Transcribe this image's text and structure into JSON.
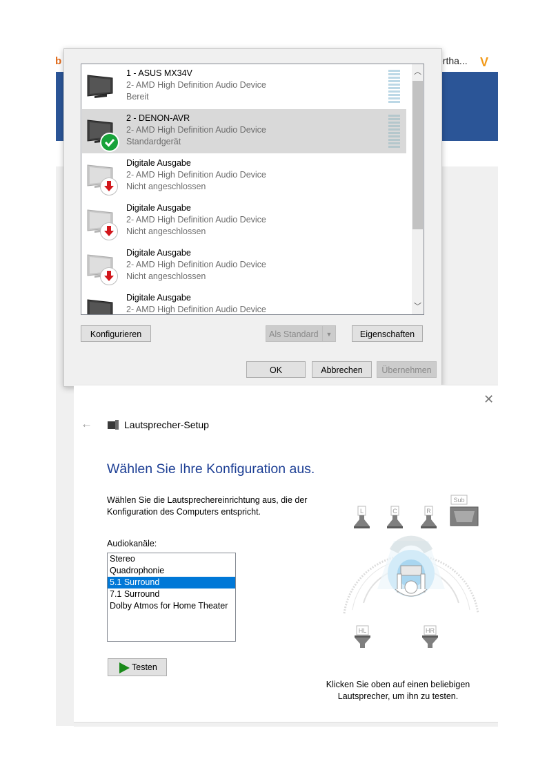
{
  "background": {
    "tab_text": "ertha...",
    "left_logo": "b",
    "right_logo": "V"
  },
  "sound_dialog": {
    "devices": [
      {
        "name": "1 - ASUS MX34V",
        "driver": "2- AMD High Definition Audio Device",
        "status": "Bereit",
        "selected": false,
        "badge": "none"
      },
      {
        "name": "2 - DENON-AVR",
        "driver": "2- AMD High Definition Audio Device",
        "status": "Standardgerät",
        "selected": true,
        "badge": "check-icon"
      },
      {
        "name": "Digitale Ausgabe",
        "driver": "2- AMD High Definition Audio Device",
        "status": "Nicht angeschlossen",
        "selected": false,
        "badge": "arrow-down-icon"
      },
      {
        "name": "Digitale Ausgabe",
        "driver": "2- AMD High Definition Audio Device",
        "status": "Nicht angeschlossen",
        "selected": false,
        "badge": "arrow-down-icon"
      },
      {
        "name": "Digitale Ausgabe",
        "driver": "2- AMD High Definition Audio Device",
        "status": "Nicht angeschlossen",
        "selected": false,
        "badge": "arrow-down-icon"
      },
      {
        "name": "Digitale Ausgabe",
        "driver": "2- AMD High Definition Audio Device",
        "status": "",
        "selected": false,
        "badge": "none"
      }
    ],
    "buttons": {
      "configure": "Konfigurieren",
      "set_default": "Als Standard",
      "properties": "Eigenschaften",
      "ok": "OK",
      "cancel": "Abbrechen",
      "apply": "Übernehmen"
    }
  },
  "speaker_setup": {
    "title": "Lautsprecher-Setup",
    "heading": "Wählen Sie Ihre Konfiguration aus.",
    "intro": "Wählen Sie die Lautsprechereinrichtung aus, die der Konfiguration des Computers entspricht.",
    "channels_label": "Audiokanäle:",
    "channels": [
      "Stereo",
      "Quadrophonie",
      "5.1 Surround",
      "7.1 Surround",
      "Dolby Atmos for Home Theater"
    ],
    "selected_channel": "5.1 Surround",
    "test_button": "Testen",
    "hint": "Klicken Sie oben auf einen beliebigen Lautsprecher, um ihn zu testen.",
    "speaker_labels": {
      "left": "L",
      "center": "C",
      "right": "R",
      "sub": "Sub",
      "rear_left": "HL",
      "rear_right": "HR"
    },
    "accent_color": "#0078d7",
    "heading_color": "#1c3e94"
  }
}
